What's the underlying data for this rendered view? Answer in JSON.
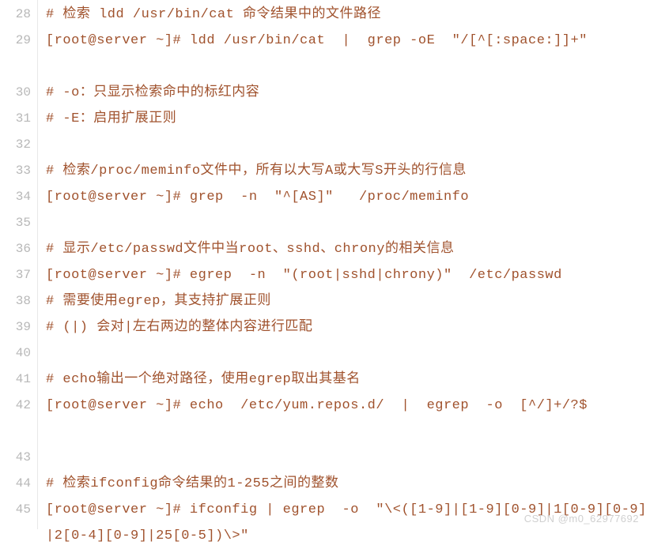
{
  "colors": {
    "text": "#a0522d",
    "gutter": "#b8b8b8",
    "gutterBorder": "#e8e8e8",
    "watermark": "#d0d0d0"
  },
  "watermark": "CSDN @m0_62977692",
  "lines": [
    {
      "num": "28",
      "text": "# 检索 ldd /usr/bin/cat 命令结果中的文件路径",
      "wrap": 1
    },
    {
      "num": "29",
      "text": "[root@server ~]# ldd /usr/bin/cat  |  grep -oE  \"/[^[:space:]]+\"",
      "wrap": 2
    },
    {
      "num": "30",
      "text": "# -o：只显示检索命中的标红内容",
      "wrap": 1
    },
    {
      "num": "31",
      "text": "# -E：启用扩展正则",
      "wrap": 1
    },
    {
      "num": "32",
      "text": "",
      "wrap": 1
    },
    {
      "num": "33",
      "text": "# 检索/proc/meminfo文件中，所有以大写A或大写S开头的行信息",
      "wrap": 1
    },
    {
      "num": "34",
      "text": "[root@server ~]# grep  -n  \"^[AS]\"   /proc/meminfo",
      "wrap": 1
    },
    {
      "num": "35",
      "text": "",
      "wrap": 1
    },
    {
      "num": "36",
      "text": "# 显示/etc/passwd文件中当root、sshd、chrony的相关信息",
      "wrap": 1
    },
    {
      "num": "37",
      "text": "[root@server ~]# egrep  -n  \"(root|sshd|chrony)\"  /etc/passwd",
      "wrap": 1
    },
    {
      "num": "38",
      "text": "# 需要使用egrep，其支持扩展正则",
      "wrap": 1
    },
    {
      "num": "39",
      "text": "# (|) 会对|左右两边的整体内容进行匹配",
      "wrap": 1
    },
    {
      "num": "40",
      "text": "",
      "wrap": 1
    },
    {
      "num": "41",
      "text": "# echo输出一个绝对路径，使用egrep取出其基名",
      "wrap": 1
    },
    {
      "num": "42",
      "text": "[root@server ~]# echo  /etc/yum.repos.d/  |  egrep  -o  [^/]+/?$",
      "wrap": 2
    },
    {
      "num": "43",
      "text": "",
      "wrap": 1
    },
    {
      "num": "44",
      "text": "# 检索ifconfig命令结果的1-255之间的整数",
      "wrap": 1
    },
    {
      "num": "45",
      "text": "[root@server ~]# ifconfig | egrep  -o  \"\\<([1-9]|[1-9][0-9]|1[0-9][0-9]|2[0-4][0-9]|25[0-5])\\>\"",
      "wrap": 2
    }
  ]
}
